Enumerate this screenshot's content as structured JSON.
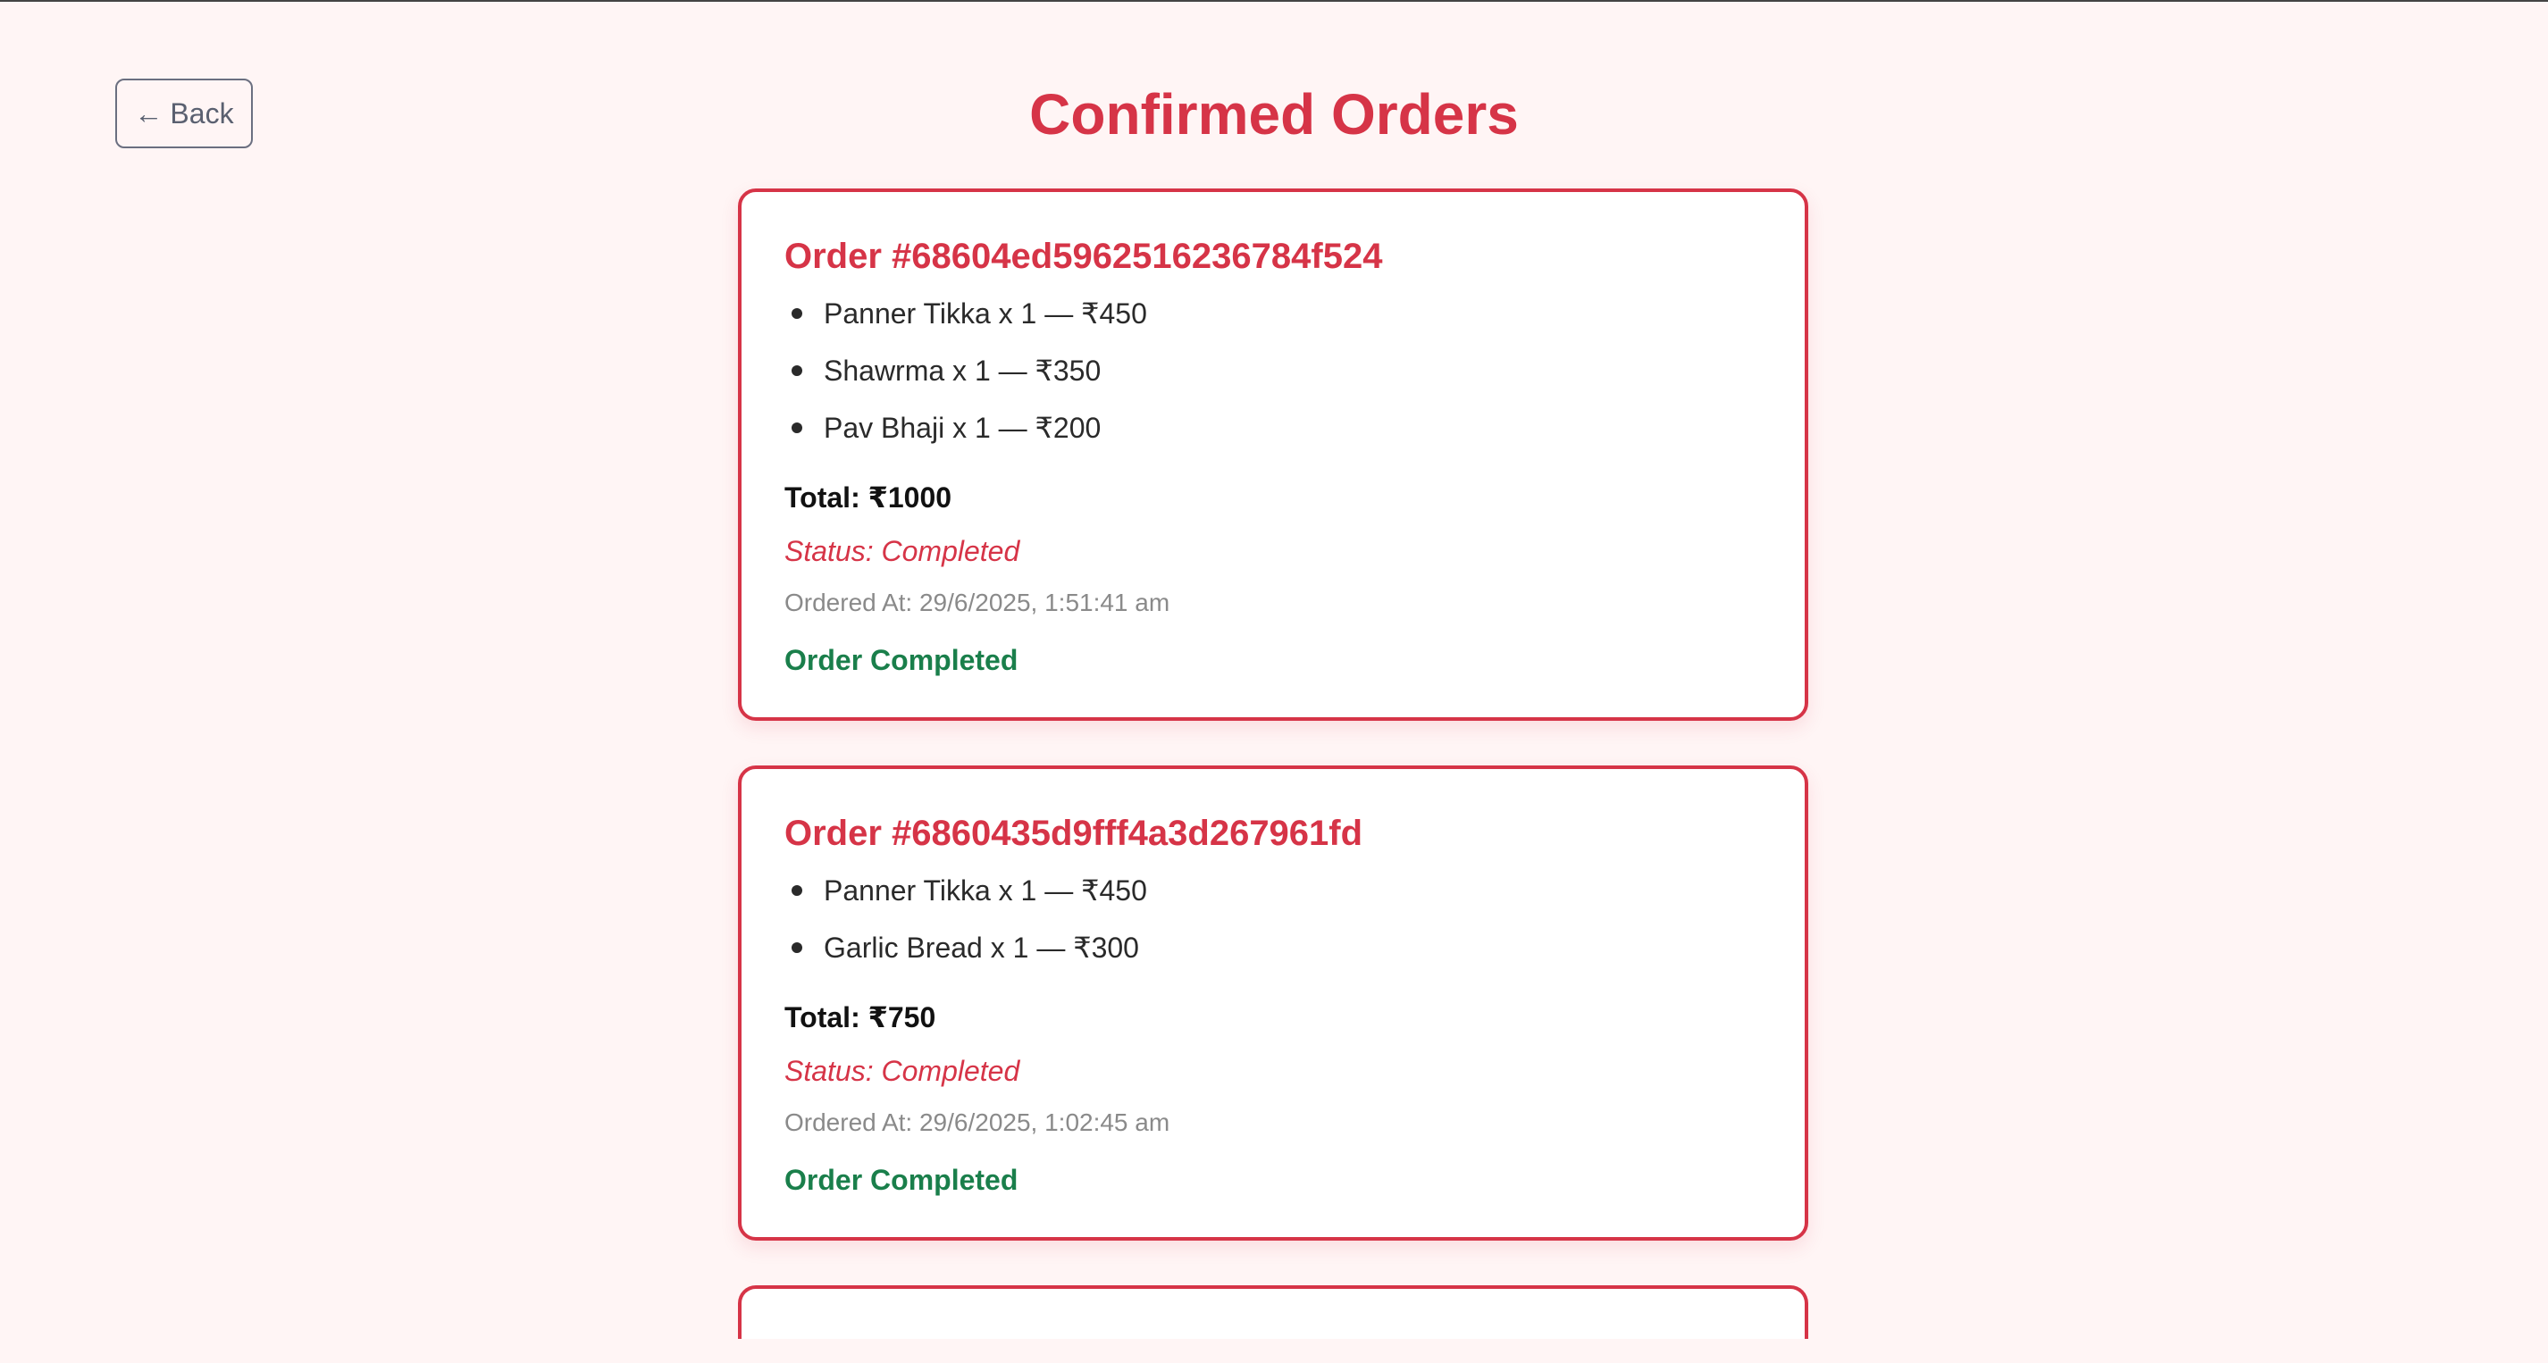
{
  "header": {
    "back_icon": "←",
    "back_label": "Back",
    "title": "Confirmed Orders"
  },
  "orders": [
    {
      "id": "Order #68604ed5962516236784f524",
      "items": [
        "Panner Tikka x 1 — ₹450",
        "Shawrma x 1 — ₹350",
        "Pav Bhaji x 1 — ₹200"
      ],
      "total": "Total: ₹1000",
      "status": "Status: Completed",
      "ordered_at": "Ordered At: 29/6/2025, 1:51:41 am",
      "completion": "Order Completed"
    },
    {
      "id": "Order #6860435d9fff4a3d267961fd",
      "items": [
        "Panner Tikka x 1 — ₹450",
        "Garlic Bread x 1 — ₹300"
      ],
      "total": "Total: ₹750",
      "status": "Status: Completed",
      "ordered_at": "Ordered At: 29/6/2025, 1:02:45 am",
      "completion": "Order Completed"
    }
  ],
  "colors": {
    "accent": "#d63447",
    "success": "#1a7f4b",
    "background": "#fff5f5",
    "muted": "#8a8a8a"
  }
}
